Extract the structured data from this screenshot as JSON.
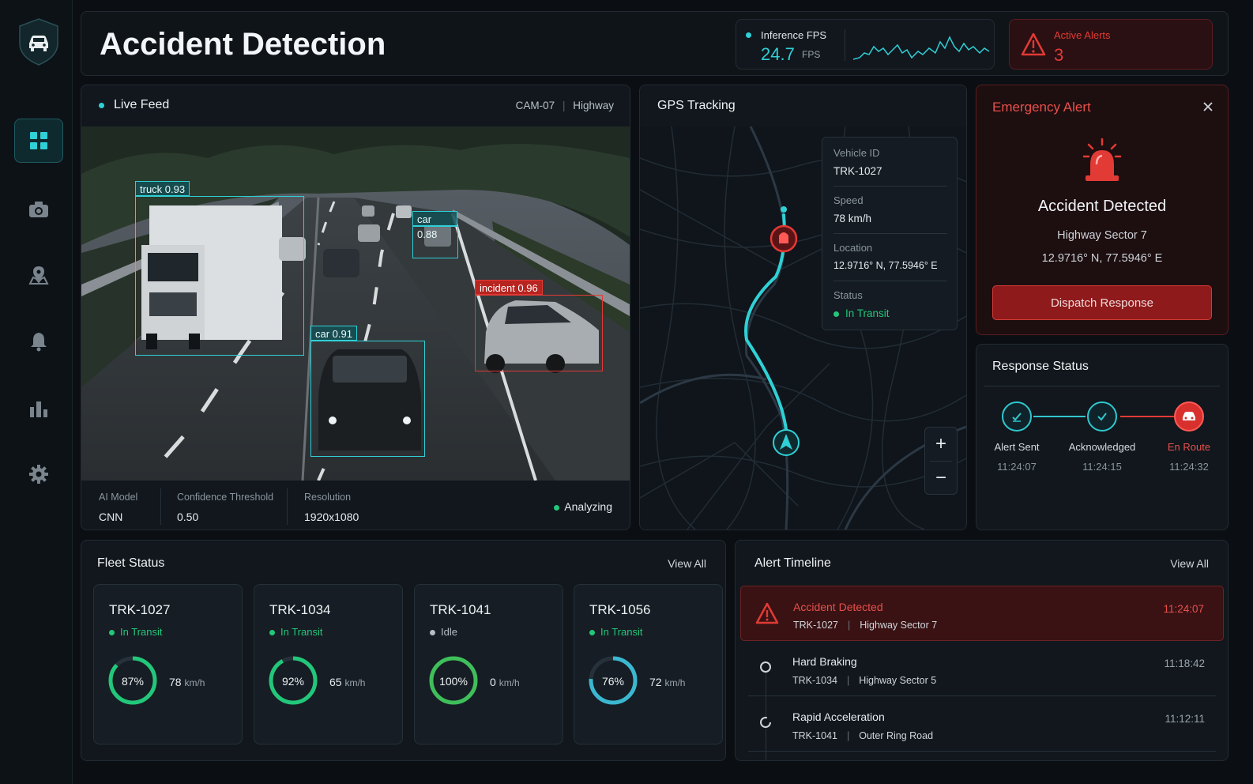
{
  "header": {
    "title": "Accident Detection"
  },
  "fps": {
    "label": "Inference FPS",
    "value": "24.7",
    "unit": "FPS"
  },
  "alerts": {
    "label": "Active Alerts",
    "count": "3"
  },
  "feed": {
    "title": "Live Feed",
    "camera": "CAM-07",
    "location": "Highway",
    "detections": [
      {
        "label": "truck 0.93"
      },
      {
        "label": "car 0.88"
      },
      {
        "label": "car 0.91"
      },
      {
        "label": "incident 0.96"
      }
    ],
    "meta": [
      {
        "k": "AI Model",
        "v": "CNN"
      },
      {
        "k": "Confidence Threshold",
        "v": "0.50"
      },
      {
        "k": "Resolution",
        "v": "1920x1080"
      }
    ],
    "status": "Analyzing"
  },
  "gps": {
    "title": "GPS Tracking",
    "info": [
      {
        "k": "Vehicle ID",
        "v": "TRK-1027"
      },
      {
        "k": "Speed",
        "v": "78 km/h"
      },
      {
        "k": "Location",
        "v": "12.9716° N, 77.5946° E"
      },
      {
        "k": "Status",
        "v": "In Transit"
      }
    ],
    "zoom_in": "+",
    "zoom_out": "−"
  },
  "emergency": {
    "title": "Emergency Alert",
    "heading": "Accident Detected",
    "sector": "Highway Sector 7",
    "coords": "12.9716° N, 77.5946° E",
    "button": "Dispatch Response"
  },
  "response": {
    "title": "Response Status",
    "steps": [
      {
        "label": "Alert Sent",
        "time": "11:24:07"
      },
      {
        "label": "Acknowledged",
        "time": "11:24:15"
      },
      {
        "label": "En Route",
        "time": "11:24:32"
      }
    ]
  },
  "fleet": {
    "title": "Fleet Status",
    "view_all": "View All",
    "vehicles": [
      {
        "id": "TRK-1027",
        "status": "In Transit",
        "pct": "87%",
        "frac": 0.87,
        "speed": "78",
        "unit": "km/h",
        "color": "#22c77a"
      },
      {
        "id": "TRK-1034",
        "status": "In Transit",
        "pct": "92%",
        "frac": 0.92,
        "speed": "65",
        "unit": "km/h",
        "color": "#22c77a"
      },
      {
        "id": "TRK-1041",
        "status": "Idle",
        "pct": "100%",
        "frac": 1.0,
        "speed": "0",
        "unit": "km/h",
        "color": "#3fbf5a"
      },
      {
        "id": "TRK-1056",
        "status": "In Transit",
        "pct": "76%",
        "frac": 0.76,
        "speed": "72",
        "unit": "km/h",
        "color": "#3bb8d0"
      }
    ]
  },
  "timeline": {
    "title": "Alert Timeline",
    "view_all": "View All",
    "items": [
      {
        "title": "Accident Detected",
        "vehicle": "TRK-1027",
        "place": "Highway Sector 7",
        "time": "11:24:07"
      },
      {
        "title": "Hard Braking",
        "vehicle": "TRK-1034",
        "place": "Highway Sector 5",
        "time": "11:18:42"
      },
      {
        "title": "Rapid Acceleration",
        "vehicle": "TRK-1041",
        "place": "Outer Ring Road",
        "time": "11:12:11"
      }
    ]
  }
}
